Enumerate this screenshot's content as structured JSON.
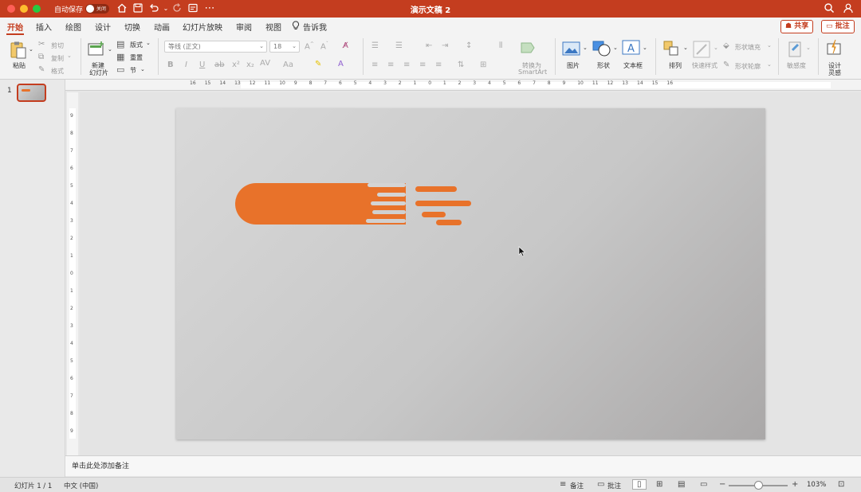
{
  "titlebar": {
    "autosave_label": "自动保存",
    "autosave_state": "关闭",
    "doc_title": "演示文稿 2",
    "bg_color": "#c43d1f"
  },
  "tabs": [
    {
      "label": "开始",
      "active": true
    },
    {
      "label": "插入"
    },
    {
      "label": "绘图"
    },
    {
      "label": "设计"
    },
    {
      "label": "切换"
    },
    {
      "label": "动画"
    },
    {
      "label": "幻灯片放映"
    },
    {
      "label": "审阅"
    },
    {
      "label": "视图"
    },
    {
      "label": "告诉我"
    }
  ],
  "tab_actions": {
    "share": "共享",
    "comment": "批注"
  },
  "ribbon": {
    "clipboard": {
      "paste": "粘贴",
      "cut": "剪切",
      "copy": "复制",
      "format": "格式"
    },
    "slides": {
      "new_slide": "新建",
      "new_slide_line2": "幻灯片",
      "layout": "版式",
      "reset": "重置",
      "section": "节"
    },
    "font": {
      "font_name": "等线 (正文)",
      "font_size": "18"
    },
    "paragraph": {
      "smartart": "转换为",
      "smartart_line2": "SmartArt"
    },
    "insert": {
      "picture": "图片",
      "shape": "形状",
      "textbox": "文本框"
    },
    "arrange": {
      "arrange": "排列",
      "quick_styles": "快速样式",
      "shape_fill": "形状填充",
      "shape_outline": "形状轮廓"
    },
    "sensitivity": "敏感度",
    "designer": "设计",
    "designer_line2": "灵感"
  },
  "ruler": {
    "h_labels": [
      "16",
      "15",
      "14",
      "13",
      "12",
      "11",
      "10",
      "9",
      "8",
      "7",
      "6",
      "5",
      "4",
      "3",
      "2",
      "1",
      "0",
      "1",
      "2",
      "3",
      "4",
      "5",
      "6",
      "7",
      "8",
      "9",
      "10",
      "11",
      "12",
      "13",
      "14",
      "15",
      "16"
    ],
    "v_labels": [
      "9",
      "8",
      "7",
      "6",
      "5",
      "4",
      "3",
      "2",
      "1",
      "0",
      "1",
      "2",
      "3",
      "4",
      "5",
      "6",
      "7",
      "8",
      "9"
    ]
  },
  "thumbnails": [
    {
      "number": "1"
    }
  ],
  "slide": {
    "accent_color": "#e8722a"
  },
  "notes": {
    "placeholder": "单击此处添加备注"
  },
  "statusbar": {
    "slide_info": "幻灯片 1 / 1",
    "language": "中文 (中国)",
    "notes": "备注",
    "comments": "批注",
    "zoom": "103%",
    "zoom_level_pct": 103
  }
}
